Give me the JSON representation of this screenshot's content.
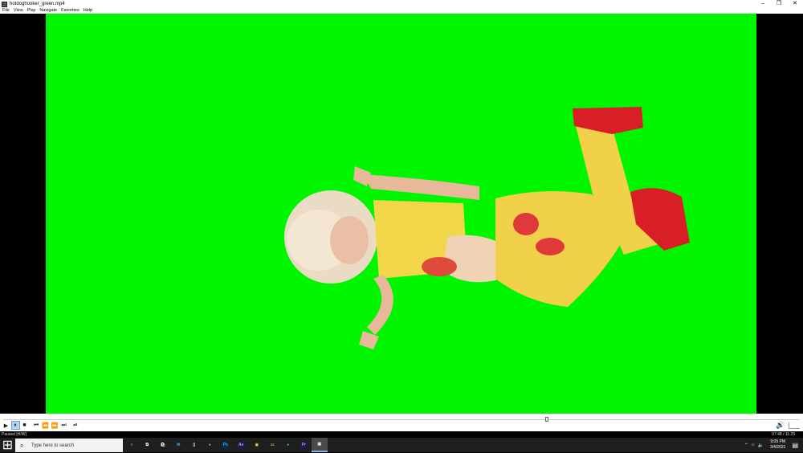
{
  "window": {
    "title": "hotdoghooker_green.mp4",
    "controls": {
      "minimize": "–",
      "restore": "❐",
      "close": "✕"
    }
  },
  "menu": [
    "File",
    "View",
    "Play",
    "Navigate",
    "Favorites",
    "Help"
  ],
  "video": {
    "background_color": "#00f500"
  },
  "player": {
    "seek_position": 0.682,
    "buttons": {
      "play": "▶",
      "pause": "⏸",
      "stop": "■",
      "prev": "⏮",
      "rewind": "⏪",
      "forward": "⏩",
      "next": "⏭",
      "frame_step": "⏯"
    },
    "volume_icon": "🔊"
  },
  "status": {
    "text": "Paused [H/W]",
    "time": "07:48 / 11:23"
  },
  "taskbar": {
    "start": "⊞",
    "search_icon": "⌕",
    "search_placeholder": "Type here to search",
    "icons": [
      {
        "name": "cortana-icon",
        "glyph": "○",
        "color": "#1f1f1f",
        "fg": "#ffffff"
      },
      {
        "name": "task-view-icon",
        "glyph": "⧉",
        "color": "#1f1f1f",
        "fg": "#ffffff"
      },
      {
        "name": "store-icon",
        "glyph": "🛍",
        "color": "#1f1f1f",
        "fg": "#ffffff"
      },
      {
        "name": "mail-icon",
        "glyph": "✉",
        "color": "#1f1f1f",
        "fg": "#4aa3df"
      },
      {
        "name": "file-icon",
        "glyph": "▯",
        "color": "#1f1f1f",
        "fg": "#ffffff"
      },
      {
        "name": "firefox-icon",
        "glyph": "●",
        "color": "#1f1f1f",
        "fg": "#ff7a1a"
      },
      {
        "name": "photoshop-icon",
        "glyph": "Ps",
        "color": "#0b2a4a",
        "fg": "#31a8ff"
      },
      {
        "name": "after-effects-icon",
        "glyph": "Ae",
        "color": "#1e1a4a",
        "fg": "#9999ff"
      },
      {
        "name": "chrome-icon",
        "glyph": "◉",
        "color": "#1f1f1f",
        "fg": "#f2c230"
      },
      {
        "name": "file-explorer-icon",
        "glyph": "▭",
        "color": "#1f1f1f",
        "fg": "#f5c242"
      },
      {
        "name": "spotify-icon",
        "glyph": "●",
        "color": "#1f1f1f",
        "fg": "#1ed760"
      },
      {
        "name": "premiere-icon",
        "glyph": "Pr",
        "color": "#1e1a4a",
        "fg": "#9999ff"
      },
      {
        "name": "media-player-icon",
        "glyph": "▣",
        "color": "#4a4a4a",
        "fg": "#e8e8e8",
        "running": true
      }
    ],
    "tray": {
      "chevron": "⌃",
      "network": "⌂",
      "volume": "🔈",
      "time": "9:05 PM",
      "date": "3/4/2021",
      "notification": "▤"
    }
  }
}
